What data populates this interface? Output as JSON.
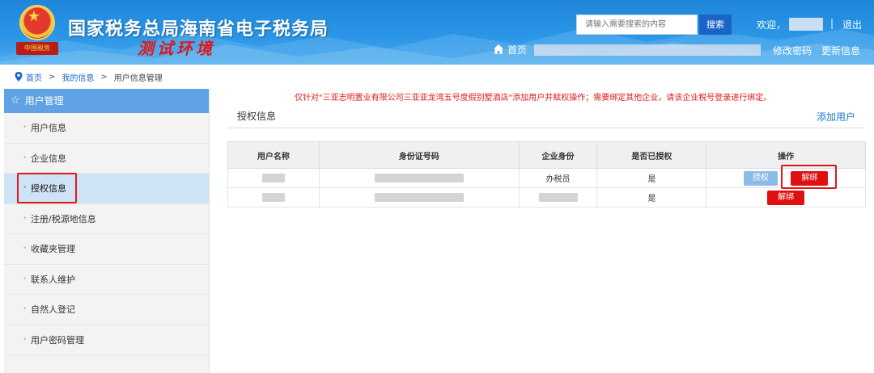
{
  "header": {
    "title": "国家税务总局海南省电子税务局",
    "test_env": "测试环境",
    "emblem_text": "中国税务",
    "search_placeholder": "请输入需要搜索的内容",
    "search_button": "搜索",
    "welcome": "欢迎，",
    "divider": "|",
    "logout": "退出",
    "home": "首页",
    "change_password": "修改密码",
    "update_info": "更新信息"
  },
  "breadcrumb": {
    "items": [
      "首页",
      "我的信息",
      "用户信息管理"
    ],
    "separator": ">"
  },
  "sidebar": {
    "header": "用户管理",
    "items": [
      {
        "label": "用户信息"
      },
      {
        "label": "企业信息"
      },
      {
        "label": "授权信息"
      },
      {
        "label": "注册/税源地信息"
      },
      {
        "label": "收藏夹管理"
      },
      {
        "label": "联系人维护"
      },
      {
        "label": "自然人登记"
      },
      {
        "label": "用户密码管理"
      }
    ],
    "active_index": 2
  },
  "main": {
    "notice": "仅针对\"三亚志明置业有限公司三亚亚龙湾五号度假别墅酒店\"添加用户并赋权操作；需要绑定其他企业，请该企业税号登录进行绑定。",
    "section_title": "授权信息",
    "add_user": "添加用户",
    "table": {
      "columns": [
        "用户名称",
        "身份证号码",
        "企业身份",
        "是否已授权",
        "操作"
      ],
      "rows": [
        {
          "role": "办税员",
          "authorized": "是",
          "actions": [
            "授权",
            "解绑"
          ]
        },
        {
          "role": "",
          "authorized": "是",
          "actions": [
            "解绑"
          ]
        }
      ]
    }
  },
  "colors": {
    "header_blue": "#2a95e6",
    "sidebar_header": "#5fa3e4",
    "active_item": "#cfe3f7",
    "notice_red": "#e01818",
    "unbind_red": "#e01010",
    "auth_blue": "#8dbbe8"
  }
}
